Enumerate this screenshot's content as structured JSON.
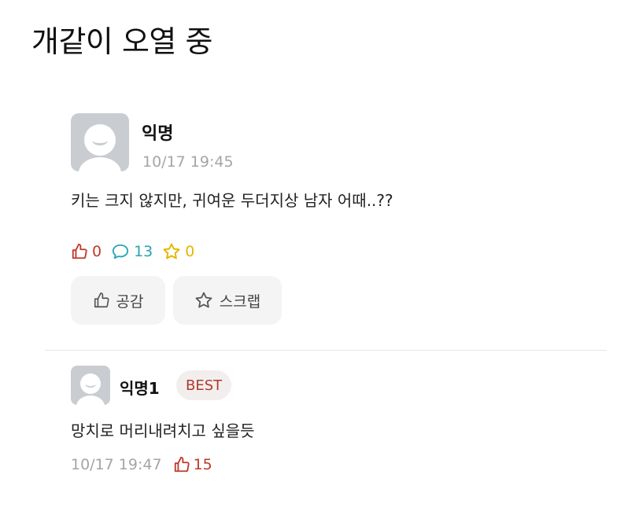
{
  "caption": "개같이 오열 중",
  "post": {
    "author": "익명",
    "time": "10/17 19:45",
    "content": "키는 크지 않지만, 귀여운 두더지상 남자 어때..??",
    "stats": {
      "likes": "0",
      "comments": "13",
      "scraps": "0"
    },
    "buttons": {
      "like_label": "공감",
      "scrap_label": "스크랩"
    },
    "colors": {
      "like": "#c0392b",
      "comment": "#2aa3b3",
      "scrap": "#e5b700"
    }
  },
  "comment": {
    "author": "익명1",
    "badge": "BEST",
    "content": "망치로 머리내려치고 싶을듯",
    "time": "10/17 19:47",
    "likes": "15"
  },
  "icons": [
    "avatar-icon",
    "thumbs-up-icon",
    "speech-bubble-icon",
    "star-icon"
  ]
}
